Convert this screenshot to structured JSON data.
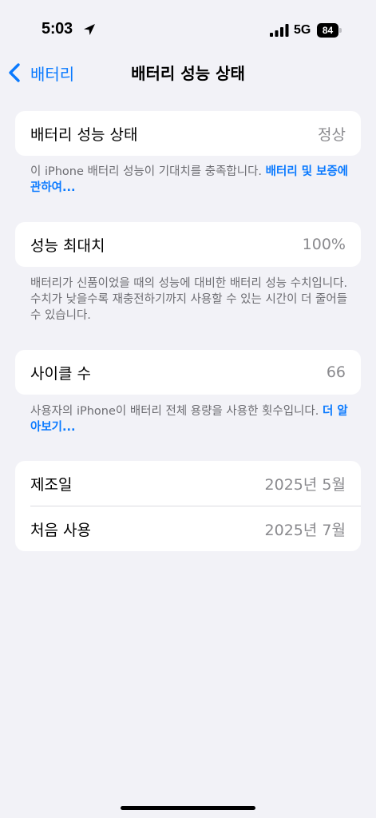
{
  "status_bar": {
    "time": "5:03",
    "network": "5G",
    "battery_level": "84"
  },
  "nav": {
    "back_label": "배터리",
    "title": "배터리 성능 상태"
  },
  "health_card": {
    "label": "배터리 성능 상태",
    "value": "정상",
    "note_text": "이 iPhone 배터리 성능이 기대치를 충족합니다. ",
    "note_link": "배터리 및 보증에 관하여..."
  },
  "capacity_card": {
    "label": "성능 최대치",
    "value": "100%",
    "note_text": "배터리가 신품이었을 때의 성능에 대비한 배터리 성능 수치입니다. 수치가 낮을수록 재충전하기까지 사용할 수 있는 시간이 더 줄어들 수 있습니다."
  },
  "cycle_card": {
    "label": "사이클 수",
    "value": "66",
    "note_text": "사용자의 iPhone이 배터리 전체 용량을 사용한 횟수입니다. ",
    "note_link": "더 알아보기..."
  },
  "dates_card": {
    "rows": [
      {
        "label": "제조일",
        "value": "2025년 5월"
      },
      {
        "label": "처음 사용",
        "value": "2025년 7월"
      }
    ]
  },
  "colors": {
    "background": "#f2f2f7",
    "accent": "#0a7aff",
    "secondary_text": "#8a8a8e"
  }
}
